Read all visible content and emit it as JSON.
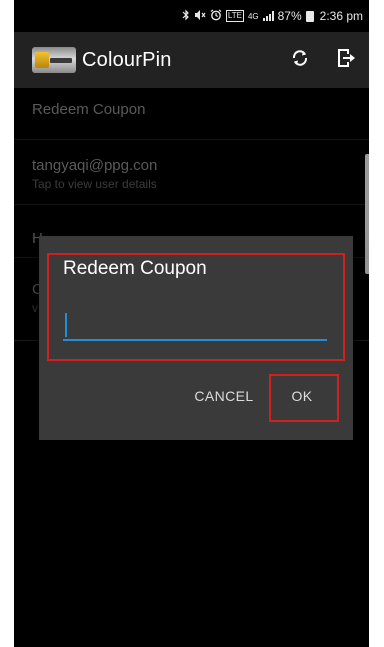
{
  "status_bar": {
    "icons": [
      "bluetooth-icon",
      "mute-icon",
      "alarm-icon",
      "volte-icon",
      "4g-icon",
      "signal-icon"
    ],
    "volte_text": "LTE",
    "network_text": "4G",
    "battery": "87%",
    "time": "2:36 pm"
  },
  "app_bar": {
    "title": "ColourPin",
    "logo": "colourpin-logo",
    "actions": [
      "refresh-icon",
      "logout-icon"
    ]
  },
  "menu": {
    "items": [
      {
        "primary": "Redeem Coupon",
        "secondary": ""
      },
      {
        "primary": "tangyaqi@ppg.con",
        "secondary": "Tap to view user details"
      },
      {
        "primary": "H",
        "secondary": ""
      },
      {
        "primary": "C",
        "secondary": "v"
      }
    ]
  },
  "dialog": {
    "title": "Redeem Coupon",
    "input": {
      "value": "",
      "placeholder": ""
    },
    "cancel_label": "CANCEL",
    "ok_label": "OK"
  },
  "colors": {
    "accent": "#1f8fd8",
    "highlight": "#d21f1f",
    "app_bar": "#222222",
    "dialog": "#3a3a3a"
  }
}
